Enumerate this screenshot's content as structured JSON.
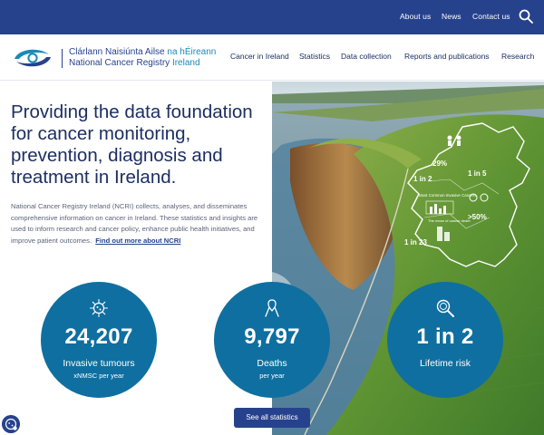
{
  "utility_nav": {
    "about": "About us",
    "news": "News",
    "contact": "Contact us"
  },
  "brand": {
    "line1": "Clárlann Naisiúnta Ailse",
    "line1_accent": "na hÉireann",
    "line2": "National Cancer Registry",
    "line2_accent": "Ireland"
  },
  "main_nav": [
    "Cancer in Ireland",
    "Statistics",
    "Data collection",
    "Reports and publications",
    "Research"
  ],
  "hero": {
    "headline": "Providing the data foundation for cancer monitoring, prevention, diagnosis and treatment in Ireland.",
    "intro": "National Cancer Registry Ireland (NCRI) collects, analyses, and disseminates comprehensive information on cancer in Ireland. These statistics and insights are used to inform research and cancer policy, enhance public health initiatives, and improve patient outcomes.",
    "link": "Find out more about NCRI"
  },
  "infographic": {
    "pct_29": "29%",
    "one_in_2": "1 in 2",
    "one_in_5": "1 in 5",
    "most_common": "Most Common Invasive Cancers",
    "gt_50": ">50%",
    "one_in_23": "1 in 23",
    "mean_age": "The mean of cancer death"
  },
  "stats": [
    {
      "value": "24,207",
      "label": "Invasive tumours",
      "sub": "xNMSC per year",
      "icon": "virus-icon"
    },
    {
      "value": "9,797",
      "label": "Deaths",
      "sub": "per year",
      "icon": "ribbon-icon"
    },
    {
      "value": "1 in 2",
      "label": "Lifetime risk",
      "sub": "",
      "icon": "magnifier-icon"
    }
  ],
  "cta": "See all statistics",
  "colors": {
    "navy": "#27428d",
    "teal": "#0f6fa0",
    "heading": "#1c2f63",
    "body_text": "#5b6478",
    "logo_accent": "#1a8ab8"
  }
}
